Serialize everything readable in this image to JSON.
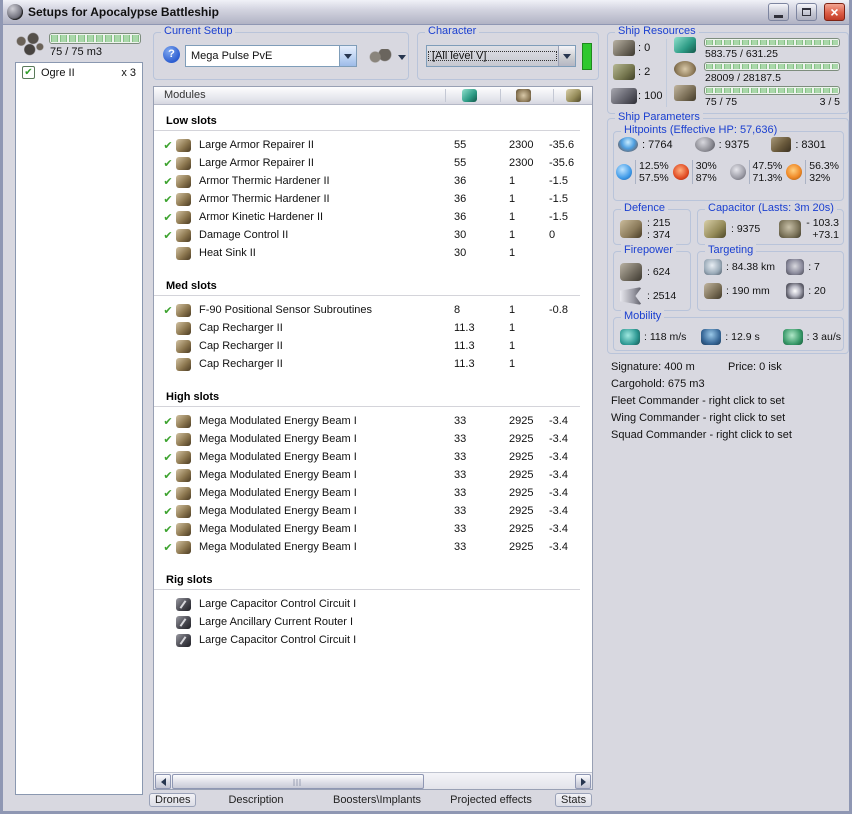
{
  "window": {
    "title": "Setups for Apocalypse Battleship"
  },
  "drone_bay": {
    "capacity": "75 / 75 m3",
    "items": [
      {
        "checked": true,
        "name": "Ogre II",
        "qty": "x 3"
      }
    ]
  },
  "current_setup": {
    "label": "Current Setup",
    "value": "Mega Pulse PvE",
    "help": "?"
  },
  "character": {
    "label": "Character",
    "value": "[All level V]"
  },
  "ship_resources": {
    "label": "Ship Resources",
    "turrets": ": 0",
    "launchers": ": 2",
    "calibration": ": 100",
    "cpu": "583.75 / 631.25",
    "powergrid": "28009 / 28187.5",
    "drone_bandwidth": "75 / 75",
    "drone_control": "3 / 5"
  },
  "ship_parameters": {
    "label": "Ship Parameters",
    "hitpoints": {
      "label": "Hitpoints (Effective HP: 57,636)",
      "shield": ": 7764",
      "armor": ": 9375",
      "structure": ": 8301",
      "em": [
        "12.5%",
        "57.5%"
      ],
      "thermal": [
        "30%",
        "87%"
      ],
      "kinetic": [
        "47.5%",
        "71.3%"
      ],
      "explosive": [
        "56.3%",
        "32%"
      ]
    },
    "defence": {
      "label": "Defence",
      "value1": ": 215",
      "value2": ": 374"
    },
    "capacitor": {
      "label": "Capacitor (Lasts: 3m 20s)",
      "amount": ": 9375",
      "drain": "- 103.3",
      "recharge": "+73.1"
    },
    "firepower": {
      "label": "Firepower",
      "volley": ": 624",
      "dps": ": 2514"
    },
    "targeting": {
      "label": "Targeting",
      "range": ": 84.38 km",
      "max_targets": ": 7",
      "scan_resolution": ": 190 mm",
      "sensor_strength": ": 20"
    },
    "mobility": {
      "label": "Mobility",
      "speed": ": 118 m/s",
      "align_time": ": 12.9 s",
      "warp_speed": ": 3 au/s"
    },
    "signature": "Signature: 400 m",
    "price": "Price: 0 isk",
    "cargohold": "Cargohold: 675 m3",
    "commanders": [
      "Fleet Commander - right click to set",
      "Wing Commander - right click to set",
      "Squad Commander - right click to set"
    ]
  },
  "modules": {
    "header": "Modules",
    "sections": [
      {
        "title": "Low slots",
        "rows": [
          {
            "checked": true,
            "icon": "armor-repairer-icon",
            "name": "Large Armor Repairer II",
            "cpu": "55",
            "pg": "2300",
            "cap": "-35.6"
          },
          {
            "checked": true,
            "icon": "armor-repairer-icon",
            "name": "Large Armor Repairer II",
            "cpu": "55",
            "pg": "2300",
            "cap": "-35.6"
          },
          {
            "checked": true,
            "icon": "hardener-icon",
            "name": "Armor Thermic Hardener II",
            "cpu": "36",
            "pg": "1",
            "cap": "-1.5"
          },
          {
            "checked": true,
            "icon": "hardener-icon",
            "name": "Armor Thermic Hardener II",
            "cpu": "36",
            "pg": "1",
            "cap": "-1.5"
          },
          {
            "checked": true,
            "icon": "hardener-icon",
            "name": "Armor Kinetic Hardener II",
            "cpu": "36",
            "pg": "1",
            "cap": "-1.5"
          },
          {
            "checked": true,
            "icon": "damage-control-icon",
            "name": "Damage Control II",
            "cpu": "30",
            "pg": "1",
            "cap": "0"
          },
          {
            "checked": false,
            "icon": "heat-sink-icon",
            "name": "Heat Sink II",
            "cpu": "30",
            "pg": "1",
            "cap": ""
          }
        ]
      },
      {
        "title": "Med slots",
        "rows": [
          {
            "checked": true,
            "icon": "sensor-subroutines-icon",
            "name": "F-90 Positional Sensor Subroutines",
            "cpu": "8",
            "pg": "1",
            "cap": "-0.8"
          },
          {
            "checked": false,
            "icon": "cap-recharger-icon",
            "name": "Cap Recharger II",
            "cpu": "11.3",
            "pg": "1",
            "cap": ""
          },
          {
            "checked": false,
            "icon": "cap-recharger-icon",
            "name": "Cap Recharger II",
            "cpu": "11.3",
            "pg": "1",
            "cap": ""
          },
          {
            "checked": false,
            "icon": "cap-recharger-icon",
            "name": "Cap Recharger II",
            "cpu": "11.3",
            "pg": "1",
            "cap": ""
          }
        ]
      },
      {
        "title": "High slots",
        "rows": [
          {
            "checked": true,
            "icon": "energy-beam-icon",
            "name": "Mega Modulated Energy Beam I",
            "cpu": "33",
            "pg": "2925",
            "cap": "-3.4"
          },
          {
            "checked": true,
            "icon": "energy-beam-icon",
            "name": "Mega Modulated Energy Beam I",
            "cpu": "33",
            "pg": "2925",
            "cap": "-3.4"
          },
          {
            "checked": true,
            "icon": "energy-beam-icon",
            "name": "Mega Modulated Energy Beam I",
            "cpu": "33",
            "pg": "2925",
            "cap": "-3.4"
          },
          {
            "checked": true,
            "icon": "energy-beam-icon",
            "name": "Mega Modulated Energy Beam I",
            "cpu": "33",
            "pg": "2925",
            "cap": "-3.4"
          },
          {
            "checked": true,
            "icon": "energy-beam-icon",
            "name": "Mega Modulated Energy Beam I",
            "cpu": "33",
            "pg": "2925",
            "cap": "-3.4"
          },
          {
            "checked": true,
            "icon": "energy-beam-icon",
            "name": "Mega Modulated Energy Beam I",
            "cpu": "33",
            "pg": "2925",
            "cap": "-3.4"
          },
          {
            "checked": true,
            "icon": "energy-beam-icon",
            "name": "Mega Modulated Energy Beam I",
            "cpu": "33",
            "pg": "2925",
            "cap": "-3.4"
          },
          {
            "checked": true,
            "icon": "energy-beam-icon",
            "name": "Mega Modulated Energy Beam I",
            "cpu": "33",
            "pg": "2925",
            "cap": "-3.4"
          }
        ]
      },
      {
        "title": "Rig slots",
        "rig": true,
        "rows": [
          {
            "checked": false,
            "icon": "rig-icon",
            "name": "Large Capacitor Control Circuit I",
            "cpu": "",
            "pg": "",
            "cap": ""
          },
          {
            "checked": false,
            "icon": "rig-icon",
            "name": "Large Ancillary Current Router I",
            "cpu": "",
            "pg": "",
            "cap": ""
          },
          {
            "checked": false,
            "icon": "rig-icon",
            "name": "Large Capacitor Control Circuit I",
            "cpu": "",
            "pg": "",
            "cap": ""
          }
        ]
      }
    ]
  },
  "tabs": [
    {
      "id": "drones",
      "label": "Drones",
      "boxed": true,
      "active": true
    },
    {
      "id": "description",
      "label": "Description"
    },
    {
      "id": "boosters",
      "label": "Boosters\\Implants"
    },
    {
      "id": "projected",
      "label": "Projected effects"
    },
    {
      "id": "stats",
      "label": "Stats",
      "boxed": true
    }
  ]
}
